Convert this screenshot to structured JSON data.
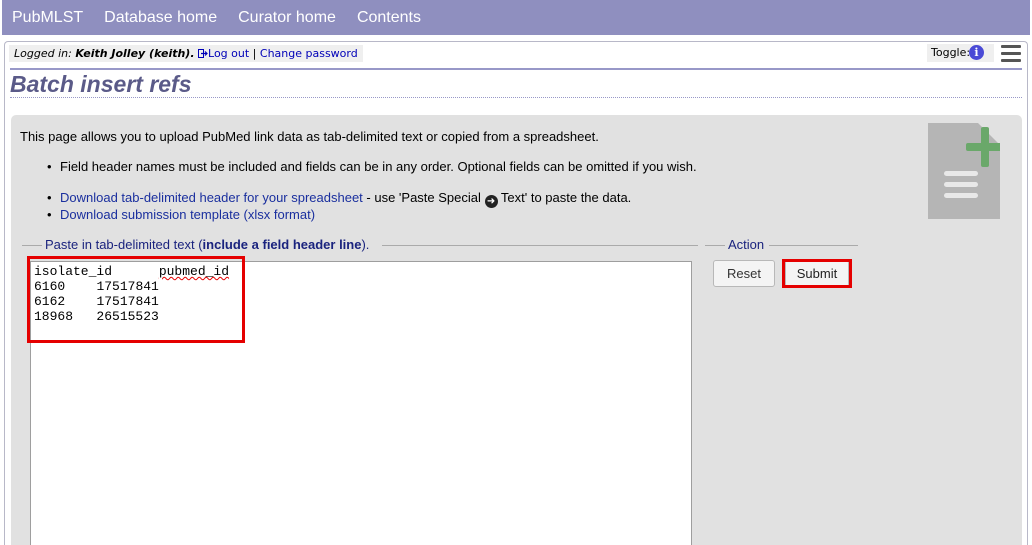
{
  "nav": {
    "items": [
      "PubMLST",
      "Database home",
      "Curator home",
      "Contents"
    ]
  },
  "login": {
    "prefix": "Logged in: ",
    "user": "Keith Jolley (keith).",
    "logout": "Log out",
    "separator": " | ",
    "change_password": "Change password"
  },
  "toggle": {
    "label": "Toggle:",
    "icon": "info-icon"
  },
  "page": {
    "title": "Batch insert refs"
  },
  "intro": "This page allows you to upload PubMed link data as tab-delimited text or copied from a spreadsheet.",
  "notes": {
    "field_header": "Field header names must be included and fields can be in any order. Optional fields can be omitted if you wish.",
    "download_header_link": "Download tab-delimited header for your spreadsheet",
    "download_header_suffix_1": " - use 'Paste Special ",
    "download_header_suffix_2": " Text' to paste the data.",
    "download_template_link": "Download submission template (xlsx format)"
  },
  "paste_fieldset": {
    "legend_prefix": "Paste in tab-delimited text (",
    "legend_bold": "include a field header line",
    "legend_suffix": ")."
  },
  "data": {
    "header": {
      "col1": "isolate_id",
      "col2": "pubmed_id"
    },
    "rows": [
      {
        "isolate_id": "6160",
        "pubmed_id": "17517841"
      },
      {
        "isolate_id": "6162",
        "pubmed_id": "17517841"
      },
      {
        "isolate_id": "18968",
        "pubmed_id": "26515523"
      }
    ]
  },
  "action_fieldset": {
    "legend": "Action",
    "reset": "Reset",
    "submit": "Submit"
  },
  "colors": {
    "nav_bg": "#8f8fbf",
    "title": "#5a5a88",
    "link": "#1a2f9e",
    "highlight": "#e50000",
    "plus_green": "#6aa86a"
  }
}
